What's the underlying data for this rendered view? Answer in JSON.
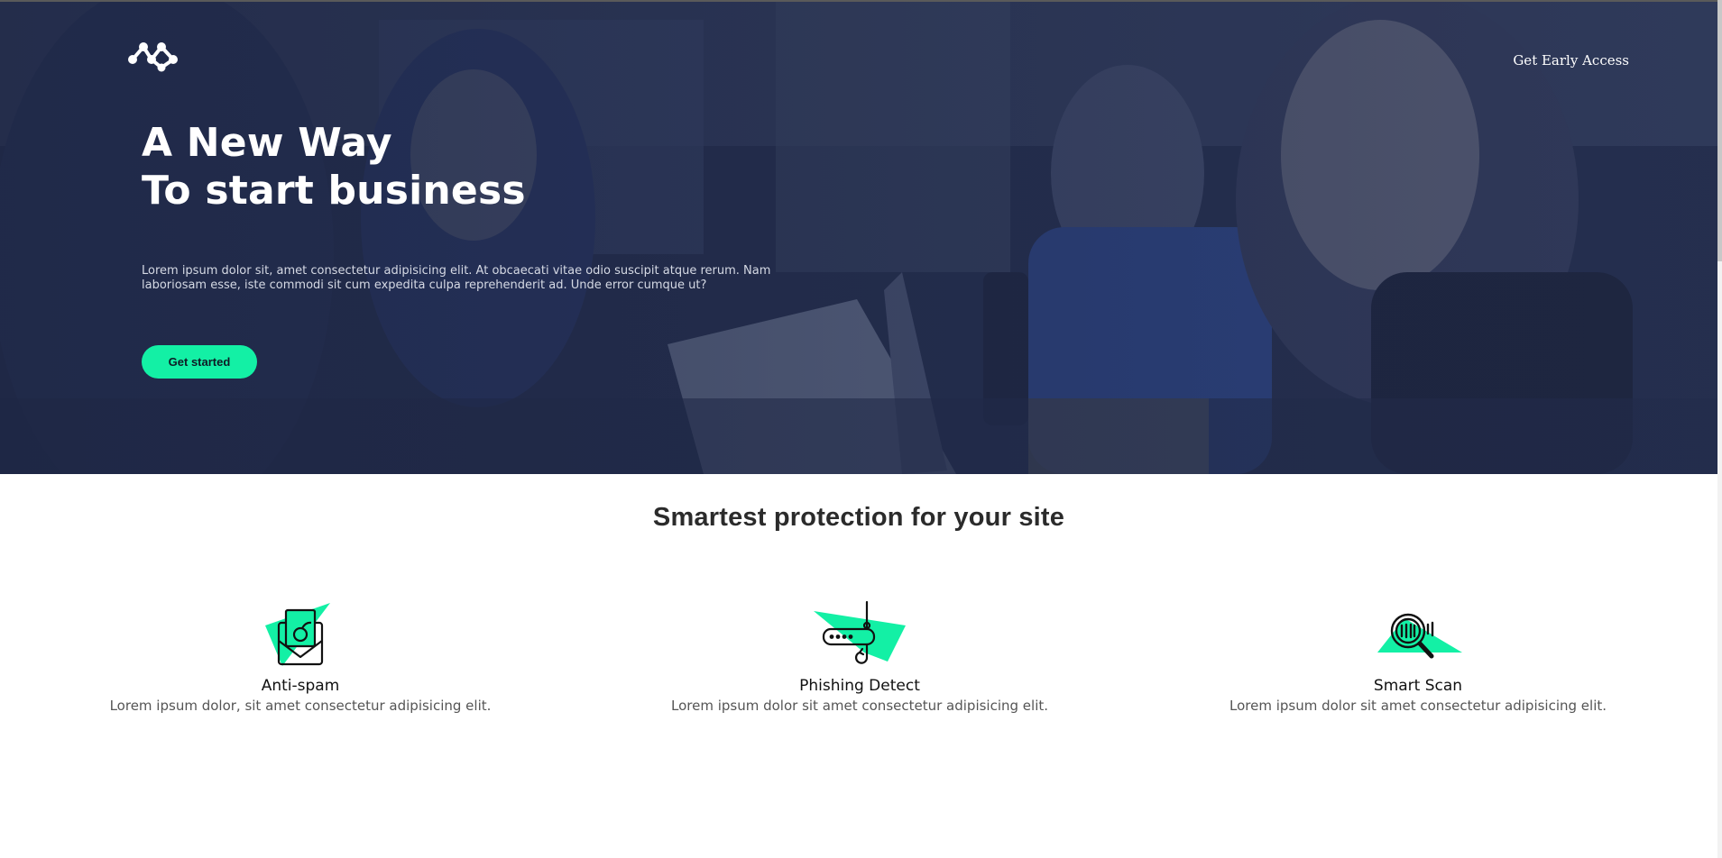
{
  "header": {
    "logo_icon": "molecule-logo-icon",
    "cta_label": "Get Early Access"
  },
  "hero": {
    "title_line1": "A New Way",
    "title_line2": "To start business",
    "description": "Lorem ipsum dolor sit, amet consectetur adipisicing elit. At obcaecati vitae odio suscipit atque rerum. Nam laboriosam esse, iste commodi sit cum expedita culpa reprehenderit ad. Unde error cumque ut?",
    "button_label": "Get started",
    "background": "team-meeting-photo"
  },
  "features": {
    "title": "Smartest protection for your site",
    "items": [
      {
        "icon": "anti-spam-envelope-bomb-icon",
        "title": "Anti-spam",
        "text": "Lorem ipsum dolor, sit amet consectetur adipisicing elit."
      },
      {
        "icon": "phishing-router-hook-icon",
        "title": "Phishing Detect",
        "text": "Lorem ipsum dolor sit amet consectetur adipisicing elit."
      },
      {
        "icon": "smart-scan-magnifier-icon",
        "title": "Smart Scan",
        "text": "Lorem ipsum dolor sit amet consectetur adipisicing elit."
      }
    ]
  },
  "colors": {
    "accent": "#13f0a5",
    "hero_overlay": "#1b2340",
    "heading": "#2b2b2b",
    "body_text": "#555555"
  }
}
